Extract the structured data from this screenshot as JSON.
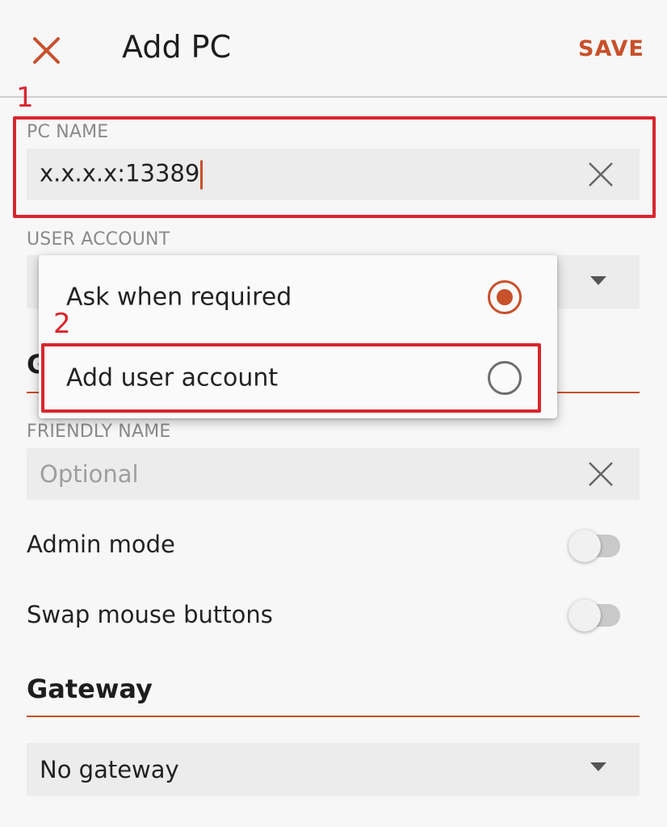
{
  "header": {
    "title": "Add PC",
    "save_label": "SAVE"
  },
  "annotations": [
    "1",
    "2"
  ],
  "pc_name": {
    "label": "PC NAME",
    "value": "x.x.x.x:13389"
  },
  "user_account": {
    "label": "USER ACCOUNT",
    "options": [
      {
        "label": "Ask when required",
        "selected": true
      },
      {
        "label": "Add user account",
        "selected": false
      }
    ]
  },
  "general": {
    "partial_title": "G"
  },
  "friendly_name": {
    "label": "FRIENDLY NAME",
    "placeholder": "Optional"
  },
  "toggles": [
    {
      "label": "Admin mode",
      "on": false
    },
    {
      "label": "Swap mouse buttons",
      "on": false
    }
  ],
  "gateway": {
    "title": "Gateway",
    "selected": "No gateway"
  },
  "colors": {
    "accent": "#c8502a",
    "annotation": "#d8262e"
  },
  "icons": [
    "close-icon",
    "clear-icon",
    "chevron-down-icon",
    "radio-selected-icon",
    "radio-unselected-icon"
  ]
}
